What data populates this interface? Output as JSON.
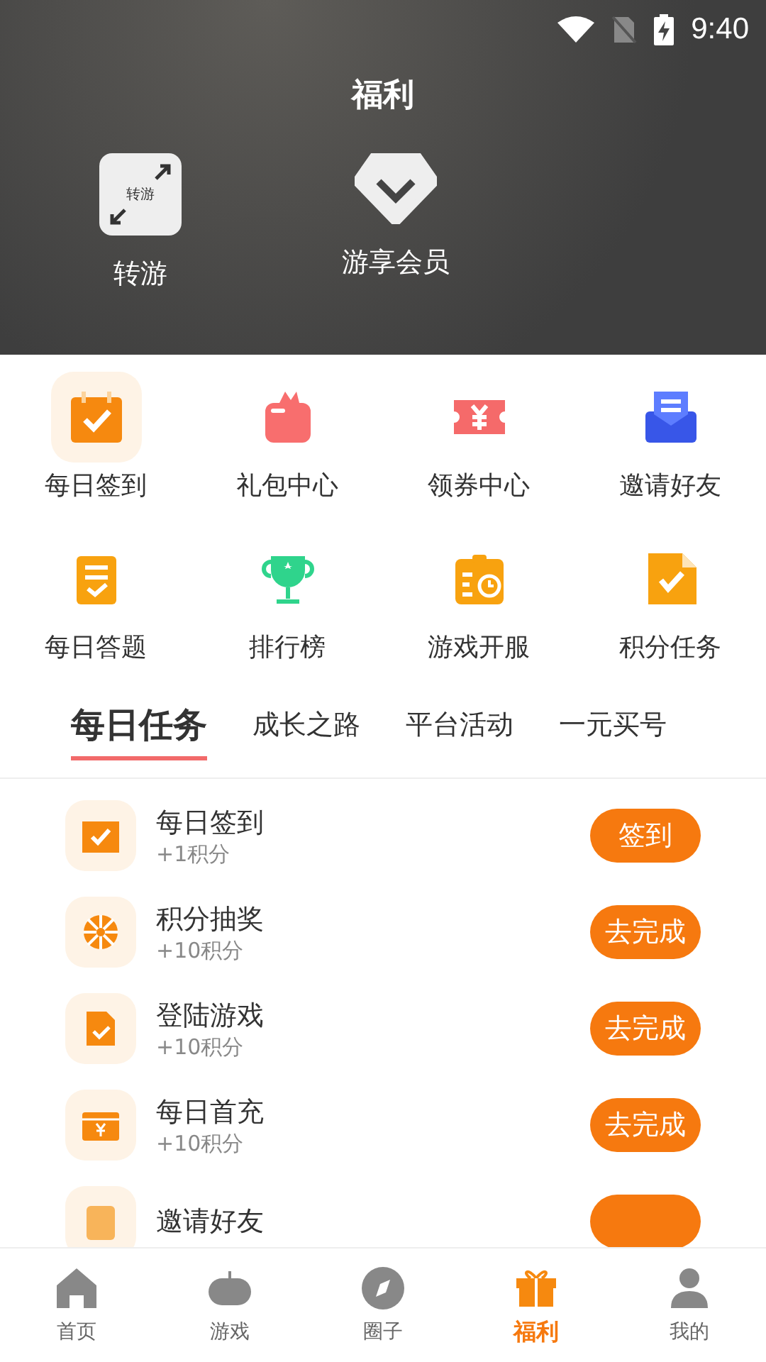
{
  "status_bar": {
    "time": "9:40"
  },
  "header": {
    "title": "福利",
    "shortcuts": [
      {
        "label": "转游",
        "icon_text": "转游"
      },
      {
        "label": "游享会员"
      }
    ]
  },
  "grid": [
    {
      "label": "每日签到",
      "selected": true
    },
    {
      "label": "礼包中心",
      "selected": false
    },
    {
      "label": "领券中心",
      "selected": false
    },
    {
      "label": "邀请好友",
      "selected": false
    },
    {
      "label": "每日答题",
      "selected": false
    },
    {
      "label": "排行榜",
      "selected": false
    },
    {
      "label": "游戏开服",
      "selected": false
    },
    {
      "label": "积分任务",
      "selected": false
    }
  ],
  "tabs": [
    {
      "label": "每日任务",
      "selected": true
    },
    {
      "label": "成长之路",
      "selected": false
    },
    {
      "label": "平台活动",
      "selected": false
    },
    {
      "label": "一元买号",
      "selected": false
    }
  ],
  "tasks": [
    {
      "title": "每日签到",
      "reward": "+1积分",
      "button": "签到"
    },
    {
      "title": "积分抽奖",
      "reward": "+10积分",
      "button": "去完成"
    },
    {
      "title": "登陆游戏",
      "reward": "+10积分",
      "button": "去完成"
    },
    {
      "title": "每日首充",
      "reward": "+10积分",
      "button": "去完成"
    },
    {
      "title": "邀请好友"
    }
  ],
  "nav": [
    {
      "label": "首页",
      "selected": false
    },
    {
      "label": "游戏",
      "selected": false
    },
    {
      "label": "圈子",
      "selected": false
    },
    {
      "label": "福利",
      "selected": true
    },
    {
      "label": "我的",
      "selected": false
    }
  ]
}
